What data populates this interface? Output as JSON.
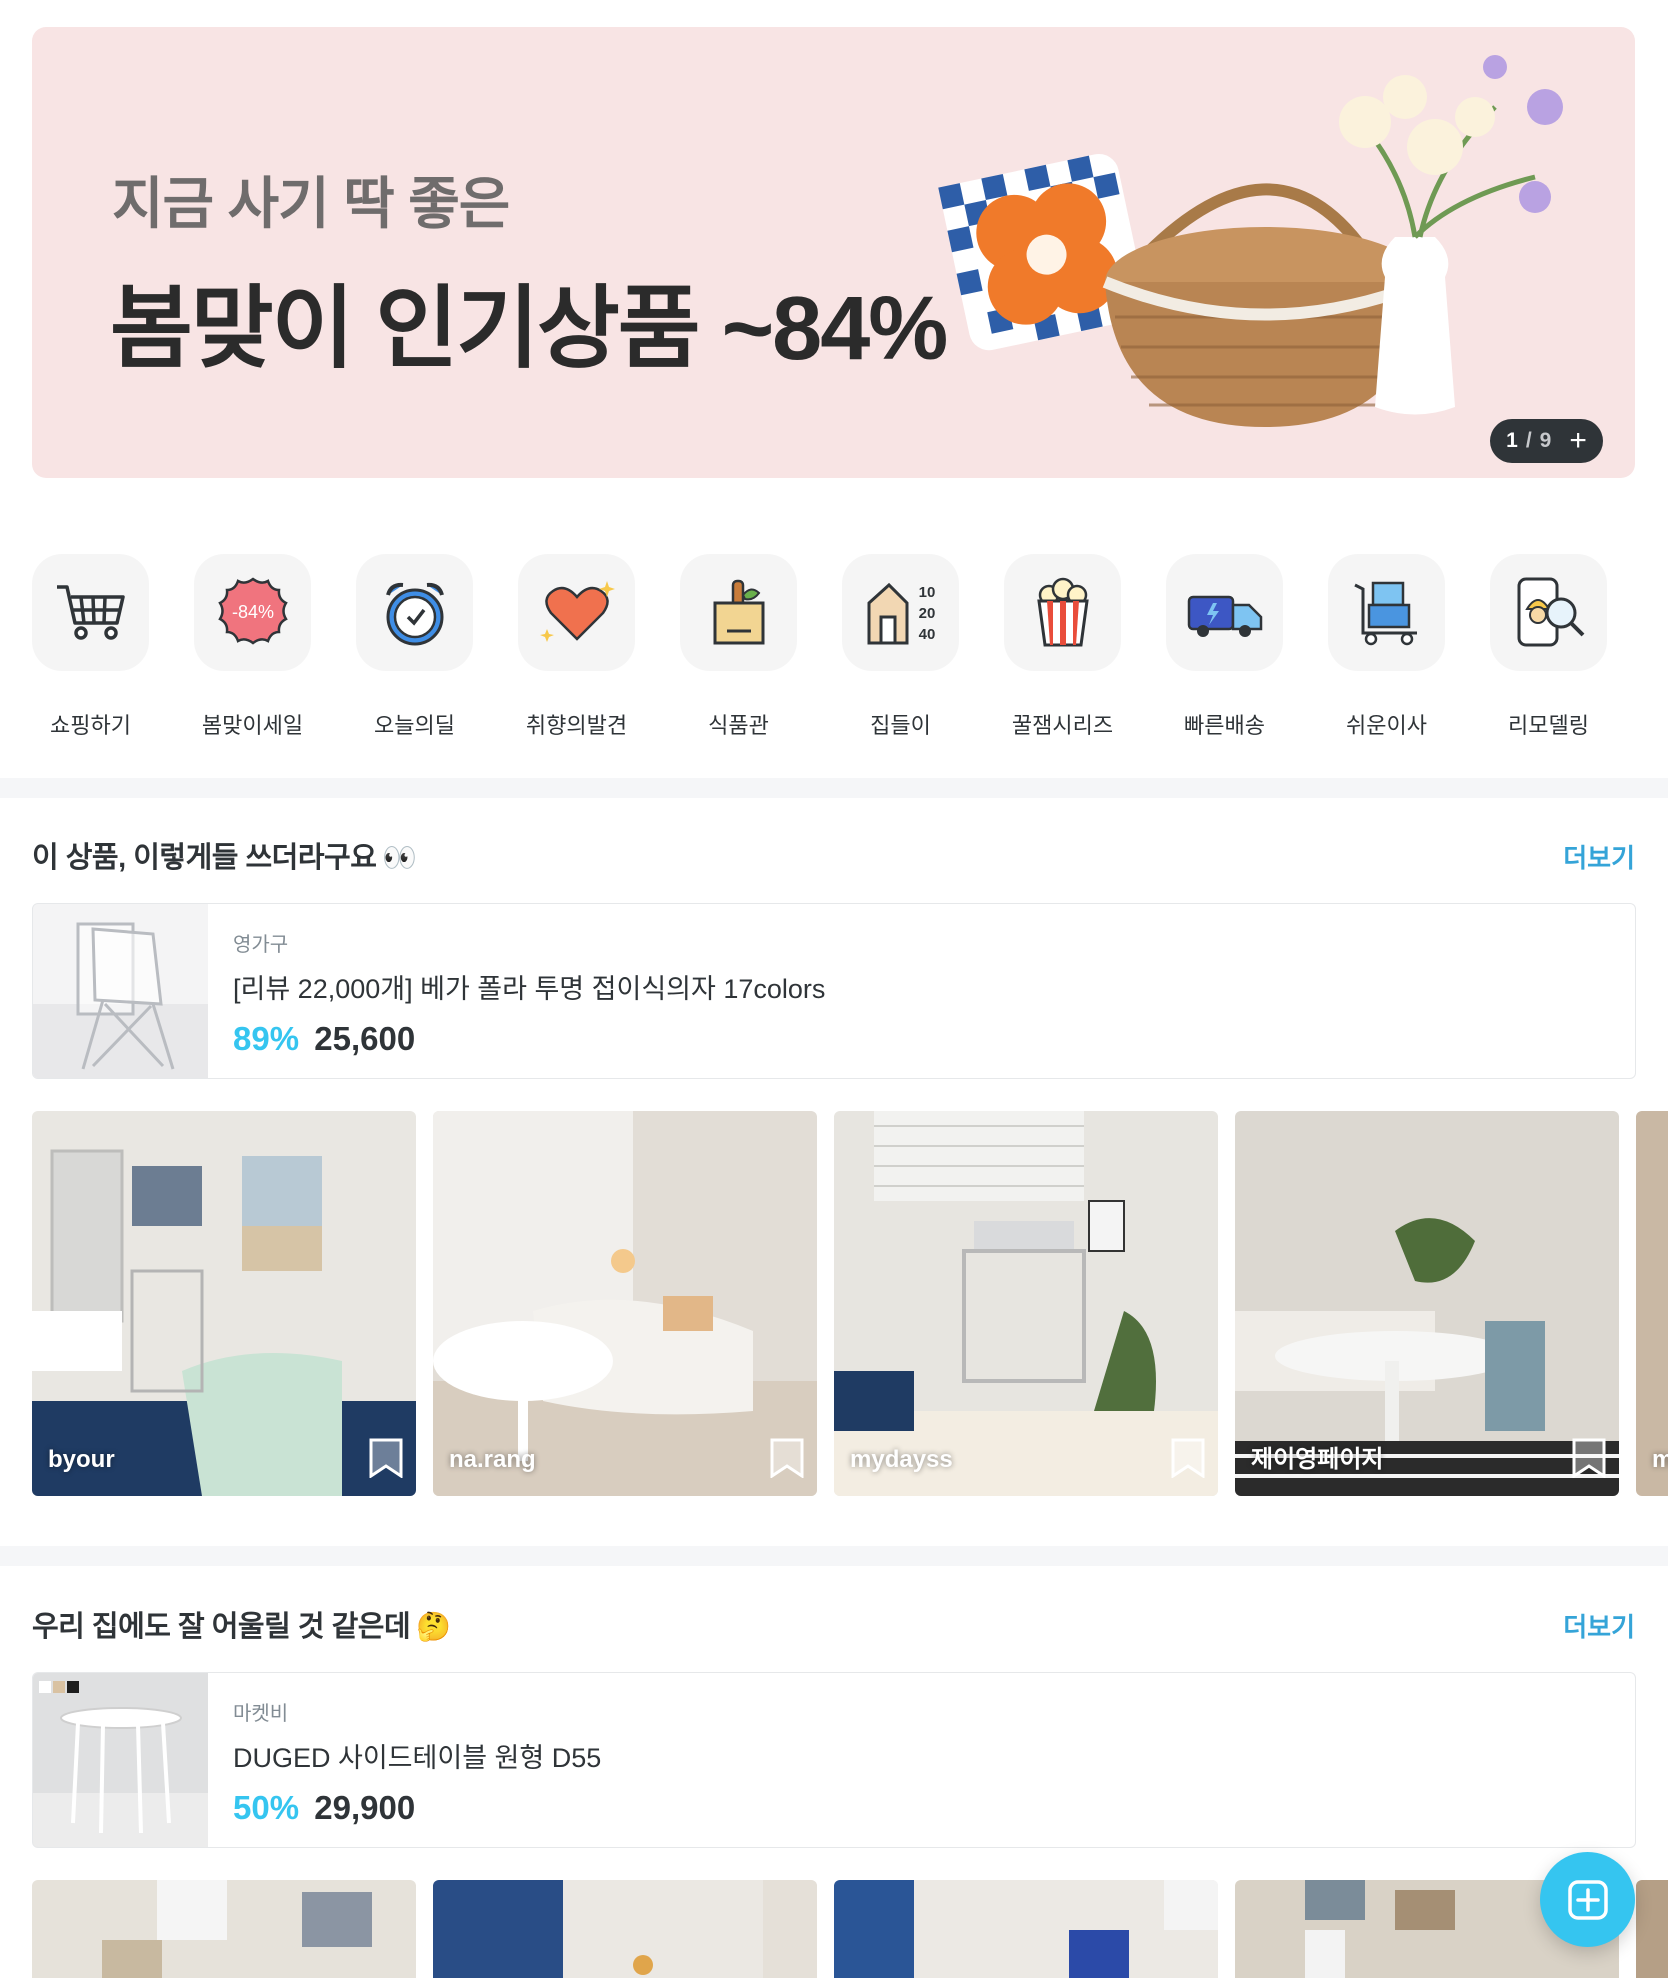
{
  "banner": {
    "subtitle": "지금 사기 딱 좋은",
    "title": "봄맞이 인기상품 ~84%",
    "pager_current": "1",
    "pager_sep": "/",
    "pager_total": "9",
    "pager_plus": "+",
    "bg_color": "#f8e4e4"
  },
  "categories": [
    {
      "label": "쇼핑하기",
      "icon": "cart-icon"
    },
    {
      "label": "봄맞이세일",
      "icon": "sale-badge-icon",
      "badge": "-84%"
    },
    {
      "label": "오늘의딜",
      "icon": "alarm-clock-icon"
    },
    {
      "label": "취향의발견",
      "icon": "heart-icon"
    },
    {
      "label": "식품관",
      "icon": "grocery-bag-icon"
    },
    {
      "label": "집들이",
      "icon": "house-size-icon",
      "sizes": [
        "10",
        "20",
        "40"
      ]
    },
    {
      "label": "꿀잼시리즈",
      "icon": "popcorn-icon"
    },
    {
      "label": "빠른배송",
      "icon": "truck-icon"
    },
    {
      "label": "쉬운이사",
      "icon": "moving-cart-icon"
    },
    {
      "label": "리모델링",
      "icon": "remodeling-icon"
    }
  ],
  "sections": [
    {
      "title": "이 상품, 이렇게들 쓰더라구요",
      "emoji": "👀",
      "more_label": "더보기",
      "product": {
        "brand": "영가구",
        "name": "[리뷰 22,000개] 베가 폴라 투명 접이식의자 17colors",
        "discount": "89%",
        "price": "25,600"
      },
      "photos": [
        {
          "user": "byour"
        },
        {
          "user": "na.rang"
        },
        {
          "user": "mydayss"
        },
        {
          "user": "제이영페이지"
        },
        {
          "user": "m"
        }
      ]
    },
    {
      "title": "우리 집에도 잘 어울릴 것 같은데",
      "emoji": "🤔",
      "more_label": "더보기",
      "product": {
        "brand": "마켓비",
        "name": "DUGED 사이드테이블 원형 D55",
        "discount": "50%",
        "price": "29,900"
      }
    }
  ],
  "colors": {
    "accent": "#35c5f0",
    "more_link": "#35a4d8",
    "text": "#2f3438"
  },
  "fab": {
    "icon": "plus-square-icon"
  }
}
